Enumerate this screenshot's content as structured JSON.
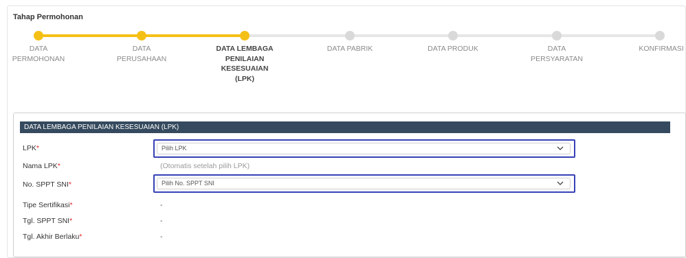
{
  "stepper": {
    "title": "Tahap Permohonan",
    "steps": [
      {
        "label": "DATA PERMOHONAN",
        "state": "done"
      },
      {
        "label": "DATA PERUSAHAAN",
        "state": "done"
      },
      {
        "label": "DATA LEMBAGA PENILAIAN KESESUAIAN (LPK)",
        "state": "current"
      },
      {
        "label": "DATA PABRIK",
        "state": "pending"
      },
      {
        "label": "DATA PRODUK",
        "state": "pending"
      },
      {
        "label": "DATA PERSYARATAN",
        "state": "pending"
      },
      {
        "label": "KONFIRMASI",
        "state": "pending"
      }
    ],
    "active_color": "#f5c016",
    "inactive_color": "#d9d9d9"
  },
  "section": {
    "header": "DATA LEMBAGA PENILAIAN KESESUAIAN (LPK)",
    "header_color": "#354a5e",
    "required_mark": "*",
    "fields": {
      "lpk": {
        "label": "LPK",
        "placeholder": "Pilih LPK"
      },
      "nama_lpk": {
        "label": "Nama LPK",
        "value": "(Otomatis setelah pilih LPK)"
      },
      "no_sppt": {
        "label": "No. SPPT SNI",
        "placeholder": "Pilih No. SPPT SNI"
      },
      "tipe_sertifikasi": {
        "label": "Tipe Sertifikasi",
        "value": "-"
      },
      "tgl_sppt": {
        "label": "Tgl. SPPT SNI",
        "value": "-"
      },
      "tgl_akhir": {
        "label": "Tgl. Akhir Berlaku",
        "value": "-"
      }
    }
  }
}
